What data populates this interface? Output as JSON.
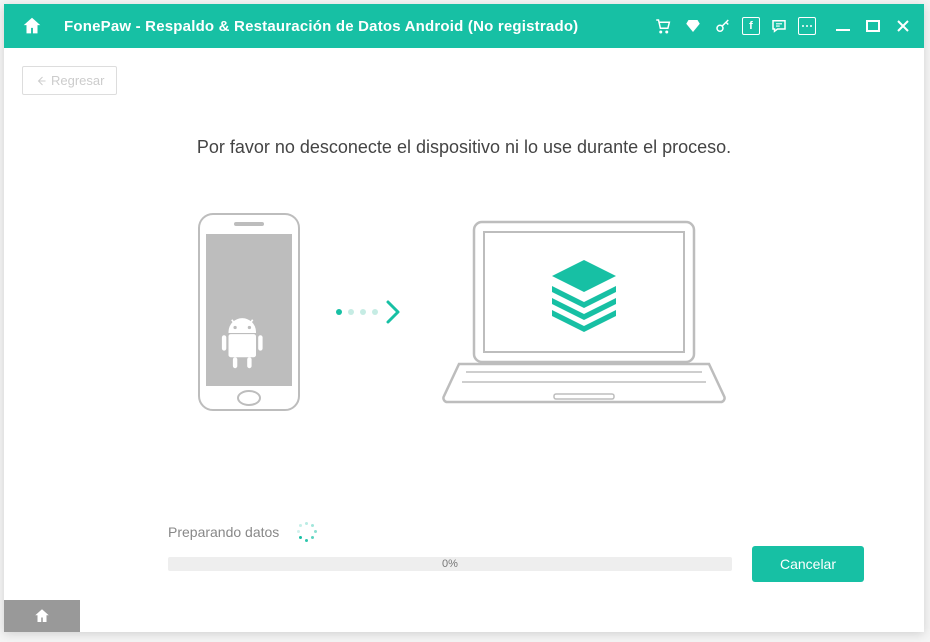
{
  "titlebar": {
    "title": "FonePaw -  Respaldo & Restauración de Datos Android (No registrado)"
  },
  "back": {
    "label": "Regresar"
  },
  "instruction": "Por favor no desconecte el dispositivo ni lo use durante el proceso.",
  "status": {
    "label": "Preparando datos"
  },
  "progress": {
    "percent_label": "0%"
  },
  "buttons": {
    "cancel": "Cancelar"
  },
  "colors": {
    "accent": "#17c0a4"
  }
}
